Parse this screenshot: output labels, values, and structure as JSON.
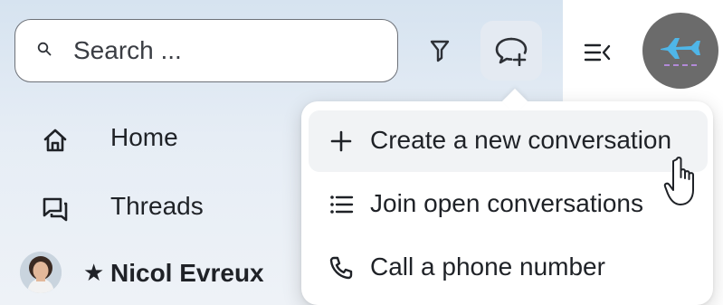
{
  "search": {
    "placeholder": "Search ..."
  },
  "toolbar": {
    "filter_icon": "filter-icon",
    "new_conversation_icon": "chat-plus-icon",
    "collapse_icon": "collapse-panel-icon",
    "avatar_icon": "airplane-icon",
    "avatar_color": "#6b6b6b"
  },
  "nav": {
    "items": [
      {
        "label": "Home",
        "icon": "home-icon"
      },
      {
        "label": "Threads",
        "icon": "threads-icon"
      }
    ]
  },
  "direct_messages": [
    {
      "name": "Nicol Evreux",
      "starred": "★",
      "avatar": "user-photo"
    }
  ],
  "popup": {
    "items": [
      {
        "label": "Create a new conversation",
        "icon": "plus-icon",
        "hovered": true
      },
      {
        "label": "Join open conversations",
        "icon": "list-icon",
        "hovered": false
      },
      {
        "label": "Call a phone number",
        "icon": "phone-icon",
        "hovered": false
      }
    ]
  },
  "colors": {
    "sidebar_bg": "#dfe8f2",
    "hover_bg": "#f1f3f5",
    "text": "#1f2227"
  }
}
